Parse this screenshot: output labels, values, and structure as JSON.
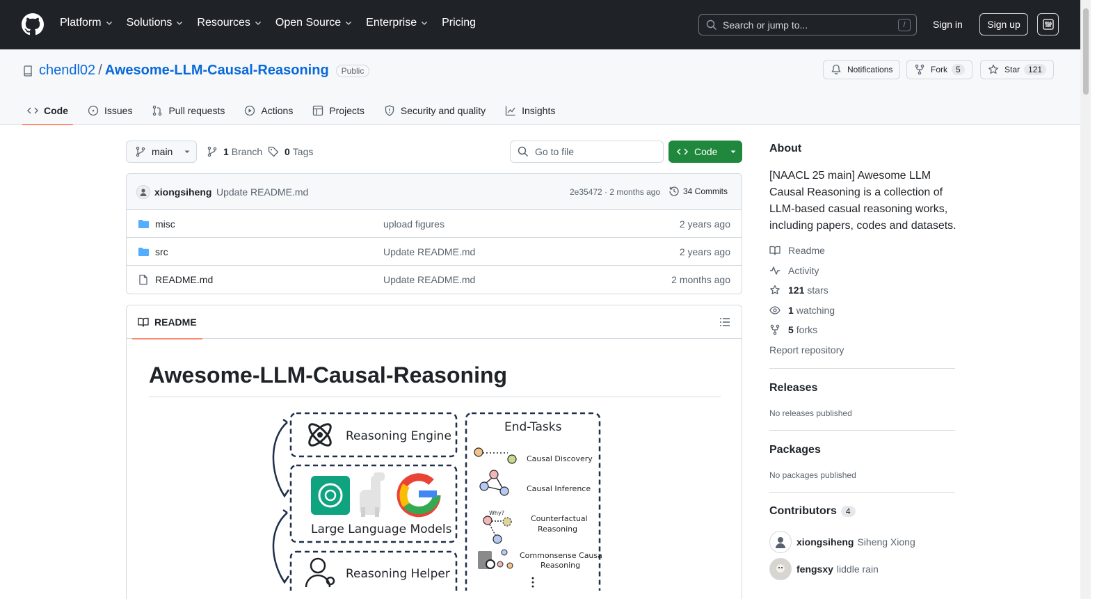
{
  "header": {
    "nav": [
      "Platform",
      "Solutions",
      "Resources",
      "Open Source",
      "Enterprise",
      "Pricing"
    ],
    "search_placeholder": "Search or jump to...",
    "search_shortcut": "/",
    "sign_in": "Sign in",
    "sign_up": "Sign up"
  },
  "repo": {
    "owner": "chendl02",
    "separator": "/",
    "name": "Awesome-LLM-Causal-Reasoning",
    "visibility": "Public",
    "notifications_label": "Notifications",
    "fork_label": "Fork",
    "fork_count": "5",
    "star_label": "Star",
    "star_count": "121",
    "tabs": [
      "Code",
      "Issues",
      "Pull requests",
      "Actions",
      "Projects",
      "Security and quality",
      "Insights"
    ]
  },
  "toolbar": {
    "branch": "main",
    "branch_count": "1",
    "branch_label": "Branch",
    "tag_count": "0",
    "tag_label": "Tags",
    "goto_placeholder": "Go to file",
    "code_label": "Code"
  },
  "commit": {
    "author": "xiongsiheng",
    "message": "Update README.md",
    "sha_age": "2e35472 · 2 months ago",
    "commits": "34 Commits"
  },
  "files": [
    {
      "name": "misc",
      "message": "upload figures",
      "age": "2 years ago",
      "type": "folder"
    },
    {
      "name": "src",
      "message": "Update README.md",
      "age": "2 years ago",
      "type": "folder"
    },
    {
      "name": "README.md",
      "message": "Update README.md",
      "age": "2 months ago",
      "type": "file"
    }
  ],
  "readme": {
    "tab": "README",
    "title": "Awesome-LLM-Causal-Reasoning",
    "figure": {
      "engine": "Reasoning Engine",
      "llms": "Large Language Models",
      "helper": "Reasoning Helper",
      "end_tasks": "End-Tasks",
      "why": "Why?",
      "tasks": [
        "Causal Discovery",
        "Causal Inference",
        "Counterfactual",
        "Reasoning",
        "Commonsense Causal",
        "Reasoning"
      ]
    }
  },
  "about": {
    "heading": "About",
    "description": "[NAACL 25 main] Awesome LLM Causal Reasoning is a collection of LLM-based casual reasoning works, including papers, codes and datasets.",
    "readme": "Readme",
    "activity": "Activity",
    "stars_count": "121",
    "stars_label": "stars",
    "watching_count": "1",
    "watching_label": "watching",
    "forks_count": "5",
    "forks_label": "forks",
    "report": "Report repository"
  },
  "releases": {
    "heading": "Releases",
    "note": "No releases published"
  },
  "packages": {
    "heading": "Packages",
    "note": "No packages published"
  },
  "contributors": {
    "heading": "Contributors",
    "count": "4",
    "people": [
      {
        "login": "xiongsiheng",
        "name": "Siheng Xiong"
      },
      {
        "login": "fengsxy",
        "name": "liddle rain"
      }
    ]
  }
}
